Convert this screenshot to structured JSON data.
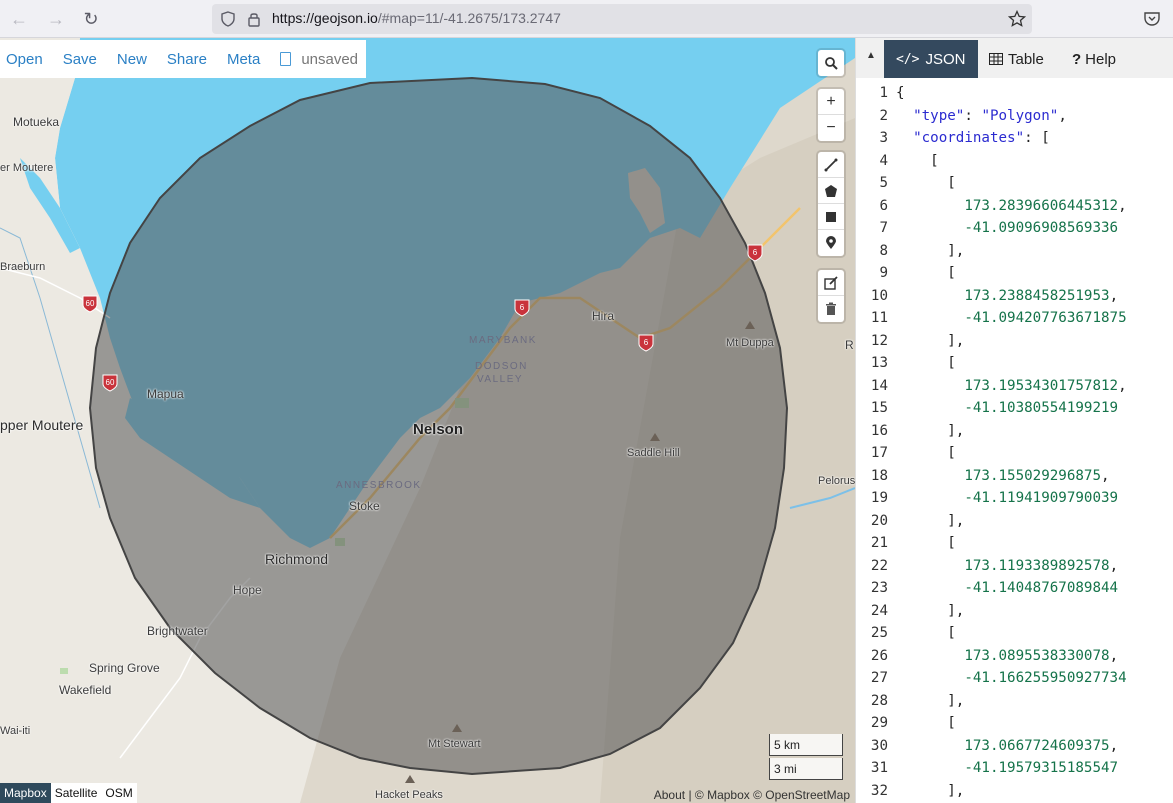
{
  "browser": {
    "url_host": "https://geojson.io",
    "url_path": "/#map=11/-41.2675/173.2747"
  },
  "menu": {
    "open": "Open",
    "save": "Save",
    "new": "New",
    "share": "Share",
    "meta": "Meta",
    "unsaved": "unsaved"
  },
  "map": {
    "places": {
      "motueka": "Motueka",
      "upper_moutere_top": "er Moutere",
      "braeburn": "Braeburn",
      "mapua": "Mapua",
      "upper_moutere": "pper Moutere",
      "nelson": "Nelson",
      "marybank": "MARYBANK",
      "dodson": "DODSON",
      "valley": "VALLEY",
      "annesbrook": "ANNESBROOK",
      "stoke": "Stoke",
      "richmond": "Richmond",
      "hope": "Hope",
      "brightwater": "Brightwater",
      "spring_grove": "Spring Grove",
      "wakefield": "Wakefield",
      "waiiti": "Wai-iti",
      "hira": "Hira",
      "mt_duppa": "Mt Duppa",
      "saddle_hill": "Saddle Hill",
      "pelorus": "Pelorus",
      "mt_stewart": "Mt Stewart",
      "hacket_peaks": "Hacket Peaks",
      "r_edge": "R"
    },
    "road_shields": [
      "60",
      "60",
      "6",
      "6",
      "6"
    ],
    "scale": {
      "km": "5 km",
      "mi": "3 mi"
    },
    "basemaps": [
      "Mapbox",
      "Satellite",
      "OSM"
    ],
    "active_basemap": "Mapbox",
    "attribution": "About | © Mapbox © OpenStreetMap",
    "polygon_fill": "#555555",
    "water_color": "#75cff0"
  },
  "panel": {
    "tabs": [
      {
        "label": "JSON",
        "icon": "code-icon",
        "active": true
      },
      {
        "label": "Table",
        "icon": "table-icon",
        "active": false
      },
      {
        "label": "Help",
        "icon": "question-icon",
        "active": false
      }
    ],
    "code_lines": [
      "{",
      "  \"type\": \"Polygon\",",
      "  \"coordinates\": [",
      "    [",
      "      [",
      "        173.28396606445312,",
      "        -41.09096908569336",
      "      ],",
      "      [",
      "        173.2388458251953,",
      "        -41.094207763671875",
      "      ],",
      "      [",
      "        173.19534301757812,",
      "        -41.10380554199219",
      "      ],",
      "      [",
      "        173.155029296875,",
      "        -41.11941909790039",
      "      ],",
      "      [",
      "        173.1193389892578,",
      "        -41.14048767089844",
      "      ],",
      "      [",
      "        173.0895538330078,",
      "        -41.166255950927734",
      "      ],",
      "      [",
      "        173.0667724609375,",
      "        -41.19579315185547",
      "      ],"
    ]
  }
}
